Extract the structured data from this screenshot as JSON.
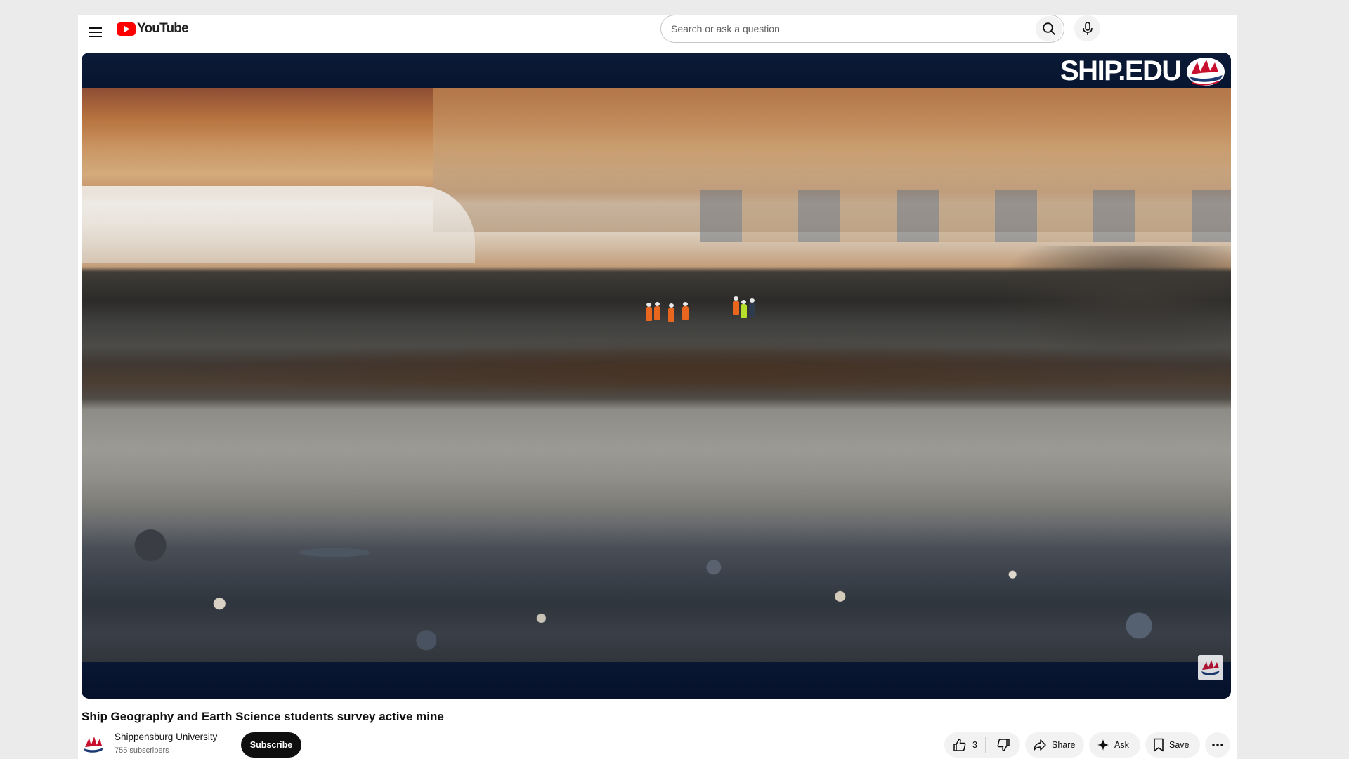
{
  "masthead": {
    "logo_text": "YouTube",
    "search": {
      "placeholder": "Search or ask a question",
      "value": ""
    },
    "icons": {
      "menu": "hamburger-menu-icon",
      "search": "search-icon",
      "mic": "microphone-icon"
    }
  },
  "player": {
    "watermark_text": "SHIP.EDU",
    "watermark_badge": "ship-sail-logo",
    "corner_badge": "ship-sail-logo"
  },
  "video": {
    "title": "Ship Geography and Earth Science students survey active mine"
  },
  "channel": {
    "name": "Shippensburg University",
    "subscribers": "755 subscribers",
    "subscribe_label": "Subscribe"
  },
  "actions": {
    "like_count": "3",
    "share_label": "Share",
    "ask_label": "Ask",
    "save_label": "Save",
    "icons": {
      "like": "thumbs-up-icon",
      "dislike": "thumbs-down-icon",
      "share": "share-arrow-icon",
      "ask": "sparkle-icon",
      "save": "bookmark-icon",
      "more": "more-horizontal-icon"
    }
  },
  "colors": {
    "youtube_red": "#ff0000",
    "frame_navy": "#0b1a36",
    "ship_red": "#c8102e",
    "subscribe_bg": "#0f0f0f"
  }
}
